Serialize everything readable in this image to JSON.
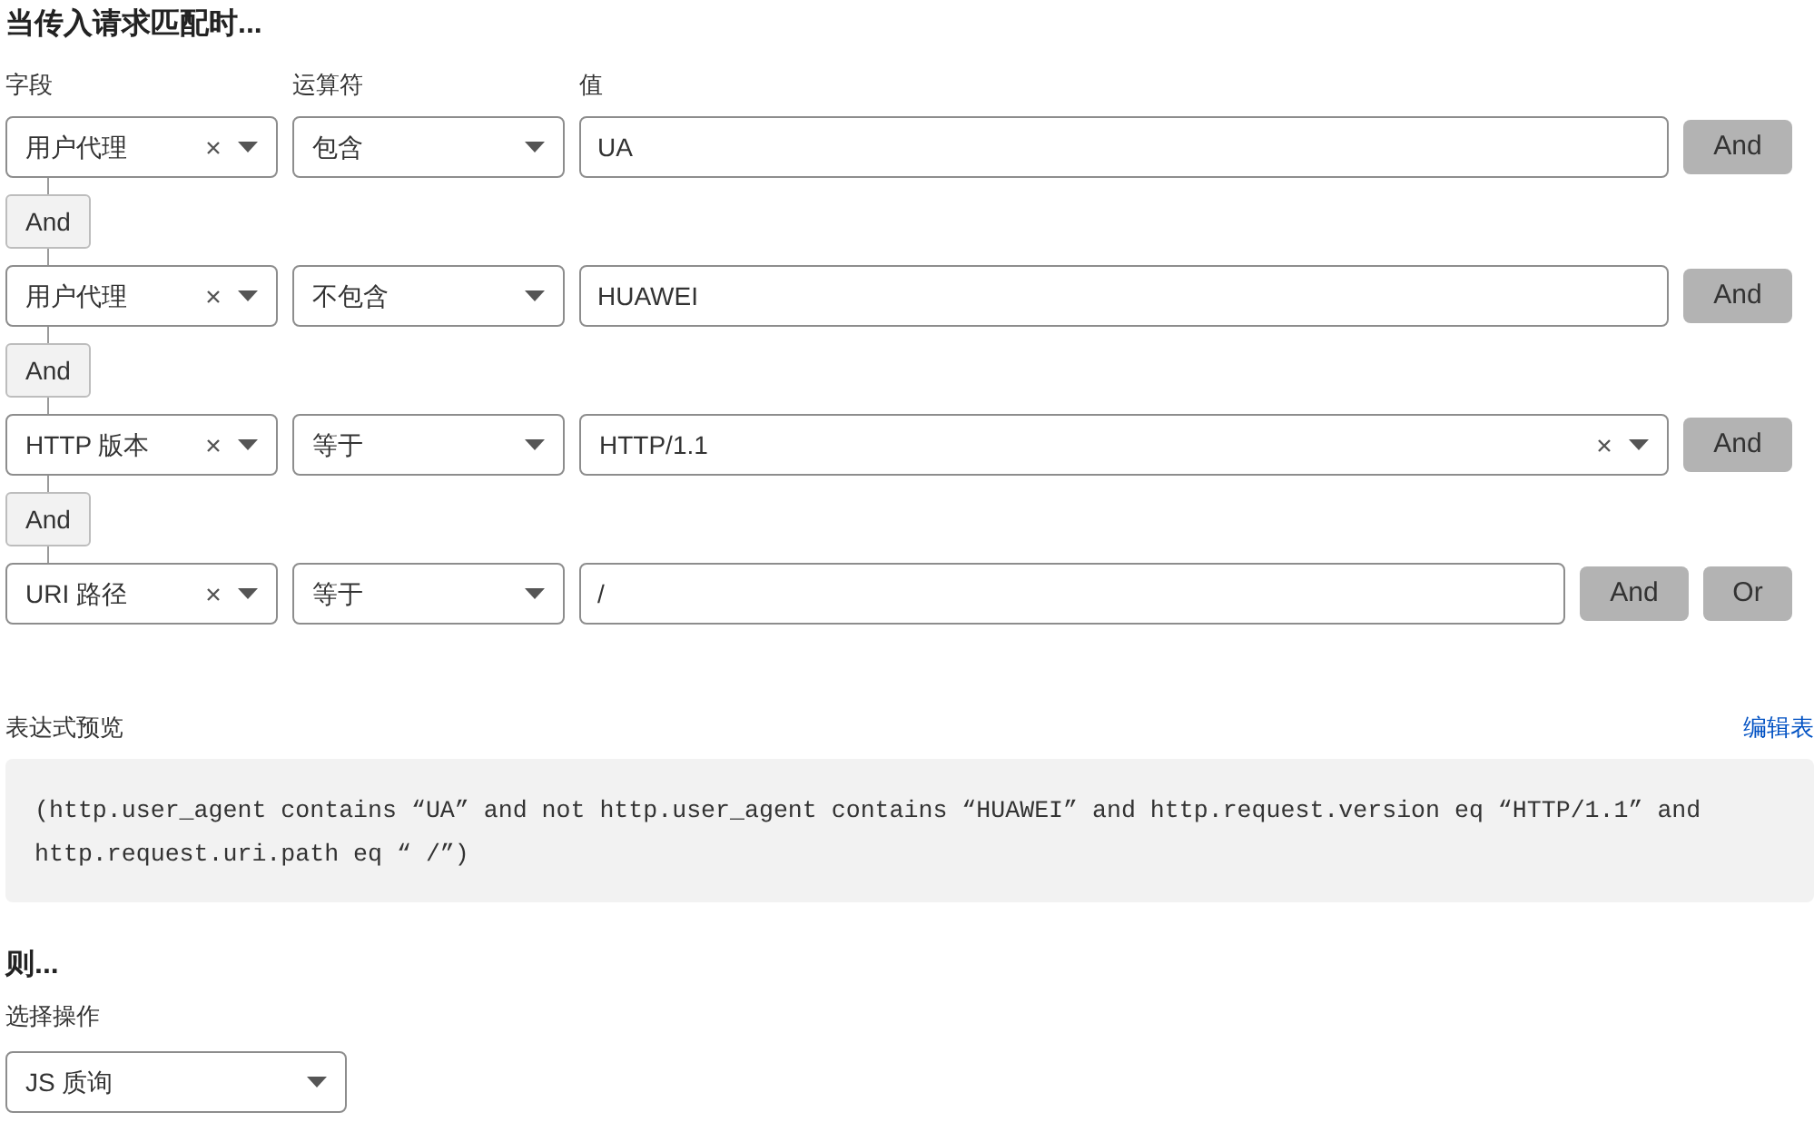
{
  "heading": "当传入请求匹配时...",
  "columns": [
    "字段",
    "运算符",
    "值"
  ],
  "conditions": [
    {
      "field": "用户代理",
      "operator": "包含",
      "value": {
        "kind": "input",
        "text": "UA"
      },
      "buttons": [
        {
          "kind": "and",
          "label": "And"
        }
      ],
      "join": "And"
    },
    {
      "field": "用户代理",
      "operator": "不包含",
      "value": {
        "kind": "input",
        "text": "HUAWEI"
      },
      "buttons": [
        {
          "kind": "and",
          "label": "And"
        }
      ],
      "join": "And"
    },
    {
      "field": "HTTP 版本",
      "operator": "等于",
      "value": {
        "kind": "select",
        "text": "HTTP/1.1"
      },
      "buttons": [
        {
          "kind": "and",
          "label": "And"
        }
      ],
      "join": "And"
    },
    {
      "field": "URI 路径",
      "operator": "等于",
      "value": {
        "kind": "input",
        "text": "/"
      },
      "buttons": [
        {
          "kind": "and",
          "label": "And"
        },
        {
          "kind": "or",
          "label": "Or"
        }
      ]
    }
  ],
  "preview": {
    "label": "表达式预览",
    "edit_link": "编辑表",
    "expression": "(http.user_agent contains “UA” and not http.user_agent contains “HUAWEI” and http.request.version eq “HTTP/1.1” and http.request.uri.path eq “ /”)"
  },
  "then": {
    "heading": "则...",
    "label": "选择操作",
    "action": "JS 质询"
  }
}
